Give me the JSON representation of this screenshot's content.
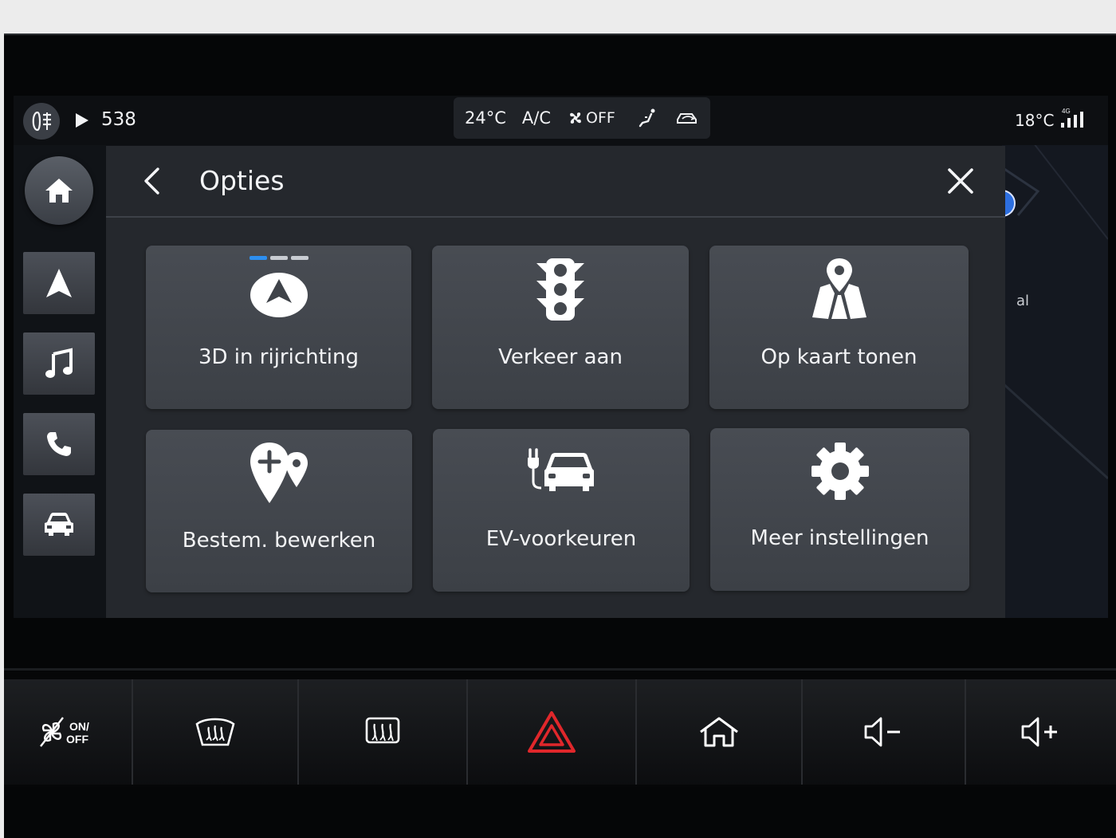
{
  "status_bar": {
    "fog_icon": "fog-light-icon",
    "station": "538",
    "climate": {
      "temperature": "24°C",
      "ac_label": "A/C",
      "fan_state": "OFF"
    },
    "outside_temperature": "18°C",
    "network": "4G"
  },
  "sidebar": {
    "items": [
      {
        "icon": "home-icon"
      },
      {
        "icon": "navigation-icon"
      },
      {
        "icon": "music-icon"
      },
      {
        "icon": "phone-icon"
      },
      {
        "icon": "car-icon"
      }
    ]
  },
  "map": {
    "label": "al"
  },
  "panel": {
    "title": "Opties",
    "tiles": [
      {
        "label": "3D in rijrichting",
        "icon": "compass-arrow-icon"
      },
      {
        "label": "Verkeer aan",
        "icon": "traffic-light-icon"
      },
      {
        "label": "Op kaart tonen",
        "icon": "map-pin-icon"
      },
      {
        "label": "Bestem. bewerken",
        "icon": "add-destination-icon"
      },
      {
        "label": "EV-voorkeuren",
        "icon": "ev-charging-icon"
      },
      {
        "label": "Meer instellingen",
        "icon": "gear-icon"
      }
    ]
  },
  "hardware_buttons": {
    "climate_toggle_on": "ON/",
    "climate_toggle_off": "OFF",
    "colors": {
      "hazard": "#e0272b",
      "accent": "#2d8ff0"
    }
  }
}
